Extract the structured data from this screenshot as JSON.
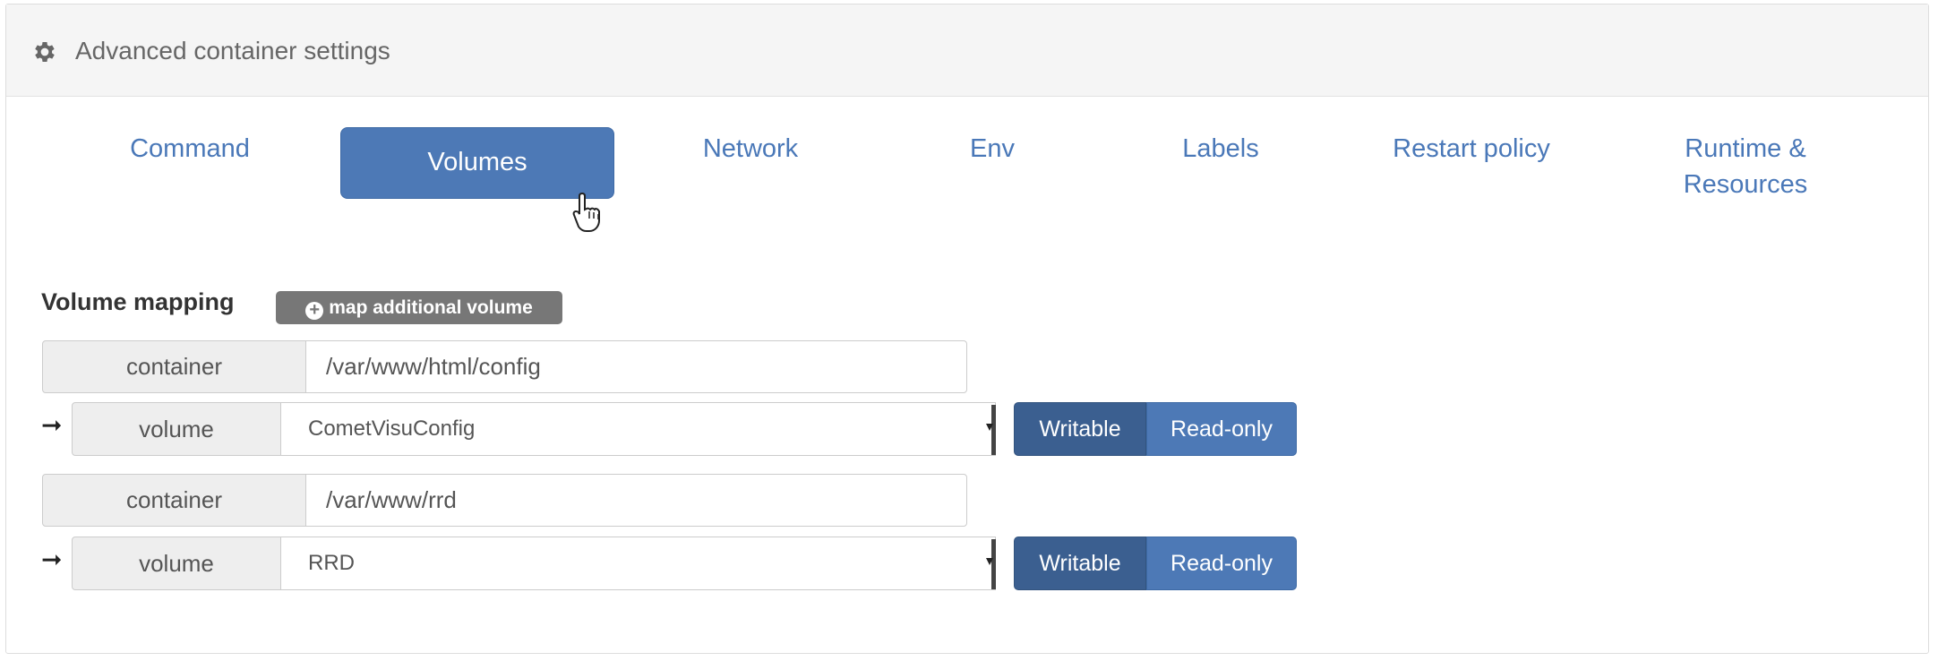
{
  "panel": {
    "title": "Advanced container settings"
  },
  "tabs": [
    {
      "label": "Command",
      "active": false
    },
    {
      "label": "Volumes",
      "active": true
    },
    {
      "label": "Network",
      "active": false
    },
    {
      "label": "Env",
      "active": false
    },
    {
      "label": "Labels",
      "active": false
    },
    {
      "label": "Restart policy",
      "active": false
    },
    {
      "label": "Runtime &\nResources",
      "active": false
    }
  ],
  "volumes": {
    "title": "Volume mapping",
    "add_button": "map additional volume",
    "add_icon": "+",
    "arrow_glyph": "➞",
    "mappings": [
      {
        "container_label": "container",
        "container_path": "/var/www/html/config",
        "volume_label": "volume",
        "volume_value": "CometVisuConfig",
        "writable_label": "Writable",
        "readonly_label": "Read-only",
        "selected": "Writable"
      },
      {
        "container_label": "container",
        "container_path": "/var/www/rrd",
        "volume_label": "volume",
        "volume_value": "RRD",
        "writable_label": "Writable",
        "readonly_label": "Read-only",
        "selected": "Writable"
      }
    ]
  },
  "colors": {
    "accent": "#4d79b6",
    "accent_dark": "#3b5f90",
    "tab_text": "#4a78b8",
    "badge_bg": "#777777",
    "header_bg": "#f5f5f5"
  },
  "icons": {
    "header": "gear-icon",
    "cursor": "hand-pointer-icon",
    "add": "plus-circle-icon"
  }
}
